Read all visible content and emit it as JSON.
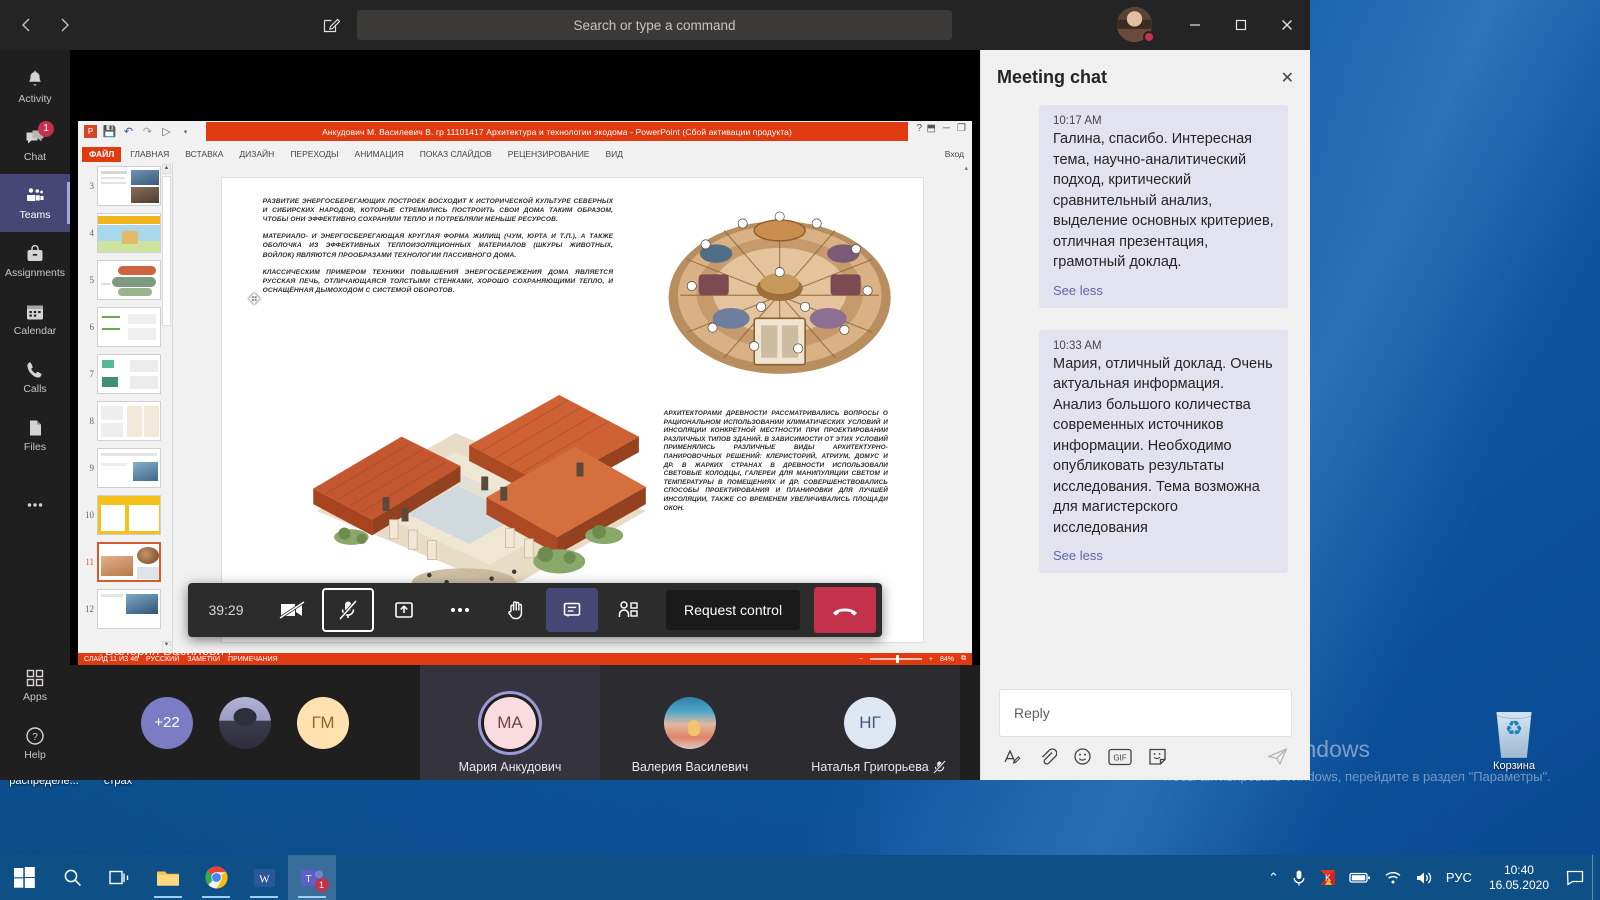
{
  "teams": {
    "titlebar": {
      "back_label": "‹",
      "forward_label": "›",
      "compose_icon": "compose-icon",
      "search_placeholder": "Search or type a command",
      "minimize_label": "─",
      "maximize_label": "☐",
      "close_label": "✕"
    },
    "rail": [
      {
        "label": "Activity",
        "icon": "bell-icon",
        "badge": ""
      },
      {
        "label": "Chat",
        "icon": "chat-icon",
        "badge": "1"
      },
      {
        "label": "Teams",
        "icon": "teams-icon",
        "badge": ""
      },
      {
        "label": "Assignments",
        "icon": "assignments-icon",
        "badge": ""
      },
      {
        "label": "Calendar",
        "icon": "calendar-icon",
        "badge": ""
      },
      {
        "label": "Calls",
        "icon": "phone-icon",
        "badge": ""
      },
      {
        "label": "Files",
        "icon": "files-icon",
        "badge": ""
      },
      {
        "label": "",
        "icon": "more-dots-icon",
        "badge": ""
      }
    ],
    "rail_bottom": [
      {
        "label": "Apps",
        "icon": "apps-icon"
      },
      {
        "label": "Help",
        "icon": "help-icon"
      }
    ],
    "toolbar": {
      "timer": "39:29",
      "camera_label": "camera-off",
      "mic_label": "mic-off",
      "share_label": "share-screen",
      "more_label": "more-options",
      "hand_label": "raise-hand",
      "chat_label": "show-conversation",
      "participants_label": "show-participants",
      "request_control": "Request control",
      "hangup_label": "hang-up"
    },
    "presenter_name": "Валерия Василевич",
    "participants": [
      {
        "type": "overflow",
        "initials": "+22",
        "name": "",
        "muted": false
      },
      {
        "type": "photo",
        "initials": "",
        "name": "",
        "muted": false
      },
      {
        "type": "initials",
        "initials": "ГМ",
        "name": "",
        "muted": false
      },
      {
        "type": "initials",
        "initials": "МА",
        "name": "Мария Анкудович",
        "muted": false,
        "speaking": true
      },
      {
        "type": "photo",
        "initials": "",
        "name": "Валерия Василевич",
        "muted": false
      },
      {
        "type": "initials",
        "initials": "НГ",
        "name": "Наталья Григорьева",
        "muted": true
      }
    ]
  },
  "chat": {
    "title": "Meeting chat",
    "close_label": "✕",
    "messages": [
      {
        "time": "10:17 AM",
        "text": "Галина, спасибо. Интересная тема, научно-аналитический подход, критический сравнительный анализ, выделение основных критериев, отличная презентация, грамотный доклад.",
        "see_label": "See less"
      },
      {
        "time": "10:33 AM",
        "text": "Мария, отличный доклад. Очень актуальная информация. Анализ большого количества современных источников информации. Необходимо опубликовать результаты исследования. Тема возможна для магистерского исследования",
        "see_label": "See less"
      }
    ],
    "reply_placeholder": "Reply",
    "tools": [
      {
        "name": "format-icon",
        "glyph": "A"
      },
      {
        "name": "attach-icon",
        "glyph": "paperclip"
      },
      {
        "name": "emoji-icon",
        "glyph": "smiley"
      },
      {
        "name": "giphy-icon",
        "glyph": "GIF"
      },
      {
        "name": "sticker-icon",
        "glyph": "sticker"
      },
      {
        "name": "send-icon",
        "glyph": "send"
      }
    ]
  },
  "powerpoint": {
    "window_title": "Анкудович М. Василевич В. гр 11101417 Архитектура и технологии экодома -  PowerPoint (Сбой активации продукта)",
    "quick_access": [
      "save-icon",
      "undo-icon",
      "redo-icon",
      "start-slideshow-icon",
      "customize-icon"
    ],
    "window_controls": {
      "help": "?",
      "ribbon_options": "⬒",
      "minimize": "─",
      "restore": "❐"
    },
    "signin_label": "Вход",
    "tabs": [
      "ФАЙЛ",
      "ГЛАВНАЯ",
      "ВСТАВКА",
      "ДИЗАЙН",
      "ПЕРЕХОДЫ",
      "АНИМАЦИЯ",
      "ПОКАЗ СЛАЙДОВ",
      "РЕЦЕНЗИРОВАНИЕ",
      "ВИД"
    ],
    "thumbnails": [
      {
        "num": "3",
        "selected": false
      },
      {
        "num": "4",
        "selected": false
      },
      {
        "num": "5",
        "selected": false
      },
      {
        "num": "6",
        "selected": false
      },
      {
        "num": "7",
        "selected": false
      },
      {
        "num": "8",
        "selected": false
      },
      {
        "num": "9",
        "selected": false
      },
      {
        "num": "10",
        "selected": false
      },
      {
        "num": "11",
        "selected": true
      },
      {
        "num": "12",
        "selected": false
      }
    ],
    "slide": {
      "paragraphs": [
        "Развитие энергосберегающих построек восходит к исторической культуре северных и сибирских народов, которые стремились построить свои дома таким образом, чтобы они эффективно сохраняли тепло и потребляли меньше ресурсов.",
        "Материало- и энергосберегающая круглая форма жилищ (чум, юрта и т.п.), а также оболочка из эффективных теплоизоляционных материалов (шкуры животных, войлок) являются прообразами технологии пассивного дома.",
        "Классическим примером техники повышения энергосбережения дома является русская печь, отличающаяся толстыми стенками, хорошо сохраняющими тепло, и оснащённая дымоходом с системой оборотов."
      ],
      "right_text": "Архитекторами древности рассматривались вопросы о рациональном использовании климатических условий и инсоляции конкретной местности при проектировании различных типов зданий. В зависимости от этих условий применялись различные виды архитектурно-панировочных решений: клеристорий, атриум, домус и др. В жарких странах в древности использовали световые колодцы, галереи для манипуляции светом и температуры в помещениях и др. Совершенствовались способы проектирования и планировки для лучшей инсоляции, также со временем увеличивались площади окон."
    },
    "status_bar": {
      "slide_counter": "СЛАЙД 11 ИЗ 46",
      "language": "РУССКИЙ",
      "notes": "ЗАМЕТКИ",
      "comments": "ПРИМЕЧАНИЯ",
      "zoom_value": "84%",
      "fit_label": "⧉"
    }
  },
  "desktop": {
    "icons": [
      {
        "label": "Заявка на распределе...",
        "name": "desktop-icon-zayavka"
      },
      {
        "label": "Картов соц страх",
        "name": "desktop-icon-kartov"
      },
      {
        "label": "Корзина",
        "name": "recycle-bin"
      }
    ],
    "activation": {
      "title": "Активация Windows",
      "subtitle": "Чтобы активировать Windows, перейдите в раздел \"Параметры\"."
    }
  },
  "taskbar": {
    "start_label": "start-icon",
    "search_label": "search-icon",
    "taskview_label": "task-view-icon",
    "apps": [
      {
        "name": "file-explorer-icon",
        "running": true,
        "active": false
      },
      {
        "name": "chrome-icon",
        "running": true,
        "active": false
      },
      {
        "name": "word-icon",
        "running": true,
        "active": false
      },
      {
        "name": "teams-icon",
        "running": true,
        "active": true,
        "badge": "1"
      }
    ],
    "tray": {
      "chevron": "⌃",
      "icons": [
        "microphone-icon",
        "kaspersky-icon",
        "battery-icon",
        "wifi-icon",
        "volume-icon"
      ],
      "language": "РУС",
      "time": "10:40",
      "date": "16.05.2020",
      "action_center": "notifications-icon"
    }
  },
  "colors": {
    "teams_accent": "#6264a7",
    "teams_rail_active": "#464775",
    "hangup_red": "#c4314b",
    "ppt_orange": "#e03a10",
    "badge_red": "#c4314b"
  }
}
